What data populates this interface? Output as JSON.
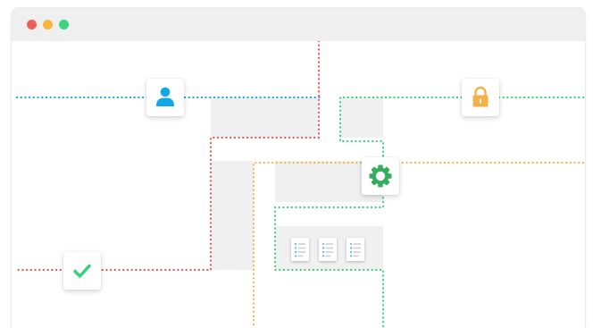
{
  "window": {
    "controls": [
      {
        "name": "close",
        "color": "#f0605a"
      },
      {
        "name": "minimize",
        "color": "#f5b540"
      },
      {
        "name": "zoom",
        "color": "#3ed37c"
      }
    ]
  },
  "colors": {
    "line_blue": "#1ea4d9",
    "line_red": "#e85454",
    "line_green": "#37cf79",
    "line_orange": "#f3b14b",
    "block_gray": "#f0f0f0",
    "user_icon": "#15a6e5",
    "lock_icon": "#f6b04a",
    "gear_icon": "#34ad5e",
    "check_icon": "#35d07a",
    "doc_line": "#c9c9c9",
    "doc_bullet": "#2fb3e2"
  },
  "nodes": [
    {
      "name": "user-node",
      "icon": "user-icon"
    },
    {
      "name": "lock-node",
      "icon": "lock-icon"
    },
    {
      "name": "gear-node",
      "icon": "gear-icon"
    },
    {
      "name": "check-node",
      "icon": "check-icon"
    }
  ],
  "documents": {
    "count": 3,
    "icon": "document-icon"
  }
}
